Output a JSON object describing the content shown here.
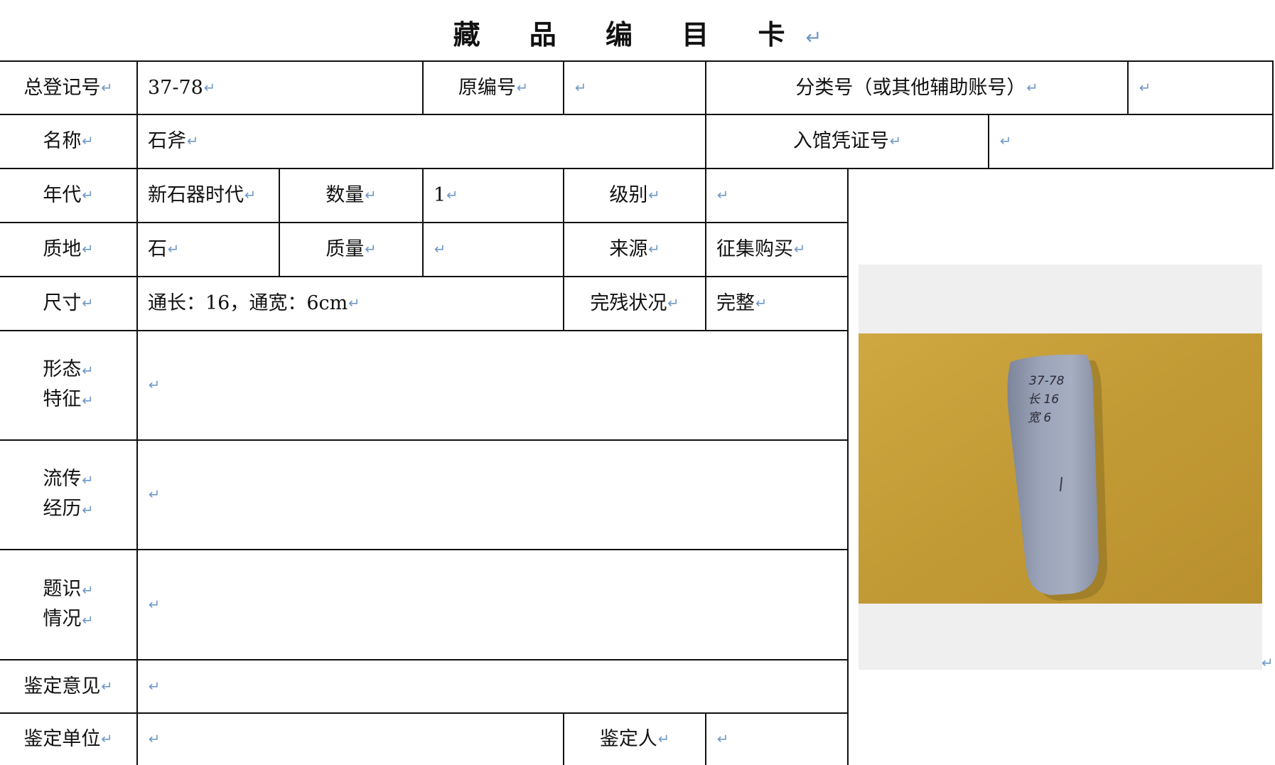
{
  "title": "藏 品 编 目 卡",
  "rows": {
    "reg_no_label": "总登记号",
    "reg_no_value": "37-78",
    "orig_no_label": "原编号",
    "orig_no_value": "",
    "class_no_label": "分类号（或其他辅助账号）",
    "class_no_value": "",
    "name_label": "名称",
    "name_value": "石斧",
    "voucher_label": "入馆凭证号",
    "voucher_value": "",
    "era_label": "年代",
    "era_value": "新石器时代",
    "qty_label": "数量",
    "qty_value": "1",
    "grade_label": "级别",
    "grade_value": "",
    "material_label": "质地",
    "material_value": "石",
    "mass_label": "质量",
    "mass_value": "",
    "source_label": "来源",
    "source_value": "征集购买",
    "size_label": "尺寸",
    "size_value": "通长：16，通宽：6cm",
    "condition_label": "完残状况",
    "condition_value": "完整",
    "form_label_1": "形态",
    "form_label_2": "特征",
    "form_value": "",
    "history_label_1": "流传",
    "history_label_2": "经历",
    "history_value": "",
    "inscription_label_1": "题识",
    "inscription_label_2": "情况",
    "inscription_value": "",
    "opinion_label": "鉴定意见",
    "opinion_value": "",
    "unit_label": "鉴定单位",
    "unit_value": "",
    "appraiser_label": "鉴定人",
    "appraiser_value": ""
  },
  "photo": {
    "subject": "stone-axe-photo",
    "handwriting": [
      "37-78",
      "长 16",
      "宽 6"
    ],
    "colors": {
      "background": "#c9a23a",
      "stone": "#8f98ad"
    }
  },
  "paragraph_mark": "↵"
}
